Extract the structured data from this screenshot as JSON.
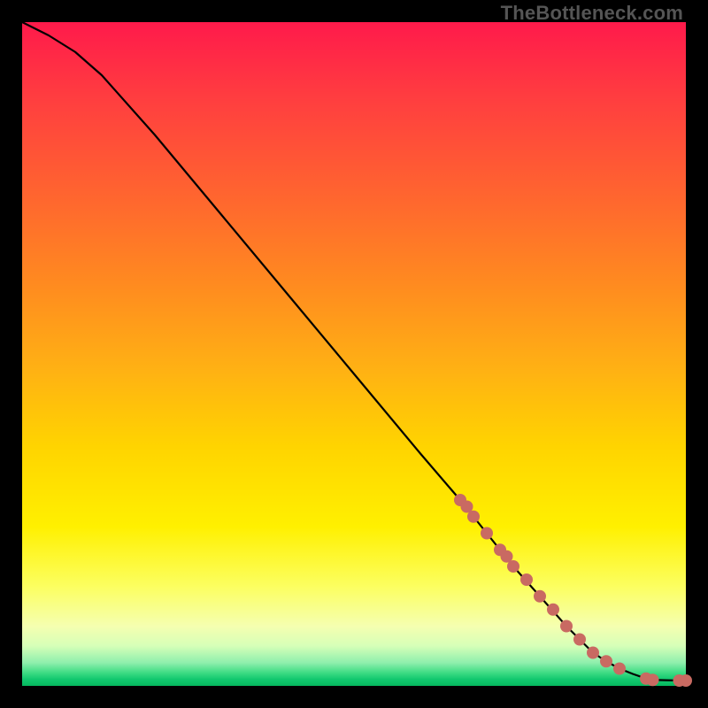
{
  "attribution": "TheBottleneck.com",
  "chart_data": {
    "type": "line",
    "title": "",
    "xlabel": "",
    "ylabel": "",
    "xlim": [
      0,
      100
    ],
    "ylim": [
      0,
      100
    ],
    "curve": {
      "name": "bottleneck-curve",
      "x": [
        0,
        4,
        8,
        12,
        20,
        30,
        40,
        50,
        60,
        66,
        70,
        74,
        78,
        82,
        86,
        88,
        90,
        92,
        94,
        95,
        97,
        100
      ],
      "y": [
        100,
        98,
        95.5,
        92,
        83,
        71,
        59,
        47,
        35,
        28,
        23,
        18,
        13.5,
        9,
        5,
        3.7,
        2.6,
        1.8,
        1.1,
        0.9,
        0.85,
        0.8
      ]
    },
    "markers": {
      "name": "highlighted-points",
      "color": "#c96a62",
      "radius_px": 7,
      "x": [
        66,
        67,
        68,
        70,
        72,
        73,
        74,
        76,
        78,
        80,
        82,
        84,
        86,
        88,
        90,
        94,
        95,
        99,
        100
      ],
      "y": [
        28,
        27,
        25.5,
        23,
        20.5,
        19.5,
        18,
        16,
        13.5,
        11.5,
        9,
        7,
        5,
        3.7,
        2.6,
        1.1,
        0.9,
        0.8,
        0.8
      ]
    }
  }
}
